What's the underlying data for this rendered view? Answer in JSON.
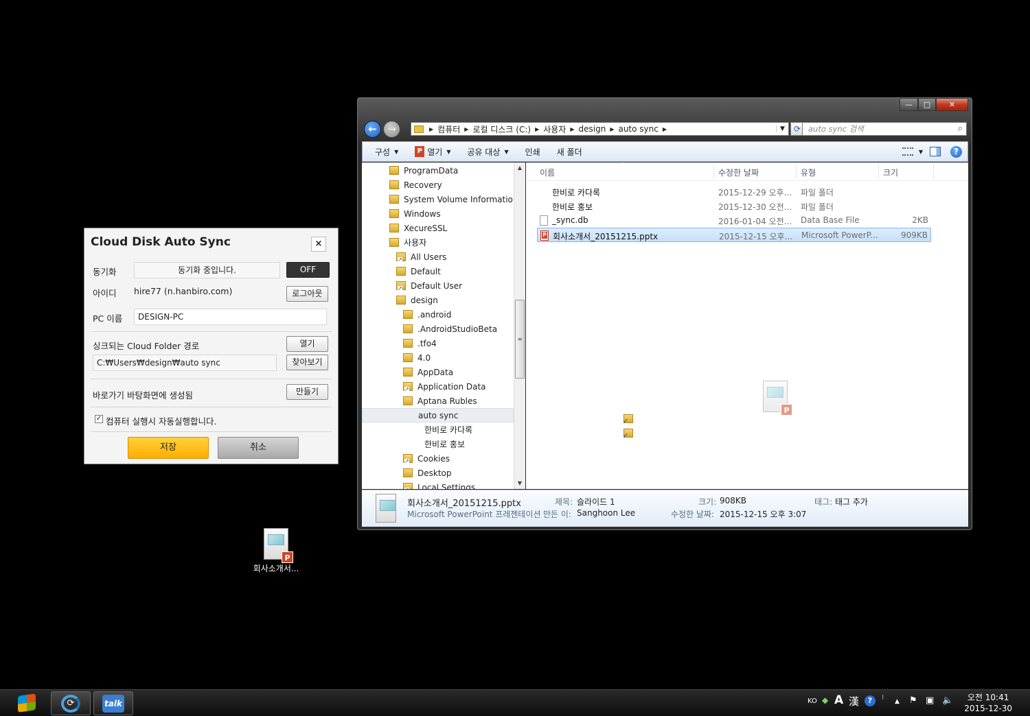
{
  "desktop": {
    "file_icon_label": "회사소개서..."
  },
  "sync_dialog": {
    "title": "Cloud Disk Auto Sync",
    "close": "×",
    "sync_label": "동기화",
    "sync_status": "동기화 중입니다.",
    "off_button": "OFF",
    "id_label": "아이디",
    "id_value": "hire77 (n.hanbiro.com)",
    "logout_button": "로그아웃",
    "pc_name_label": "PC 이름",
    "pc_name_value": "DESIGN-PC",
    "folder_label": "싱크되는 Cloud Folder 경로",
    "open_button": "열기",
    "folder_path": "C:₩Users₩design₩auto sync",
    "browse_button": "찾아보기",
    "shortcut_label": "바로가기 바탕화면에 생성됨",
    "create_button": "만들기",
    "autorun_checked": "✓",
    "autorun_label": "컴퓨터 실행시 자동실행합니다.",
    "save_button": "저장",
    "cancel_button": "취소"
  },
  "explorer": {
    "window_buttons": {
      "minimize": "—",
      "maximize": "□",
      "close": "✕"
    },
    "nav": {
      "back": "←",
      "forward": "→"
    },
    "breadcrumb": [
      "컴퓨터",
      "로컬 디스크 (C:)",
      "사용자",
      "design",
      "auto sync"
    ],
    "search_placeholder": "auto sync 검색",
    "toolbar": {
      "organize": "구성",
      "open": "열기",
      "share": "공유 대상",
      "print": "인쇄",
      "new_folder": "새 폴더"
    },
    "tree": [
      {
        "label": "ProgramData",
        "type": "folder"
      },
      {
        "label": "Recovery",
        "type": "folder"
      },
      {
        "label": "System Volume Information",
        "type": "folder"
      },
      {
        "label": "Windows",
        "type": "folder"
      },
      {
        "label": "XecureSSL",
        "type": "folder"
      },
      {
        "label": "사용자",
        "type": "folder"
      },
      {
        "label": "All Users",
        "type": "short"
      },
      {
        "label": "Default",
        "type": "folder"
      },
      {
        "label": "Default User",
        "type": "short"
      },
      {
        "label": "design",
        "type": "folder"
      },
      {
        "label": ".android",
        "type": "folder"
      },
      {
        "label": ".AndroidStudioBeta",
        "type": "folder"
      },
      {
        "label": ".tfo4",
        "type": "folder"
      },
      {
        "label": "4.0",
        "type": "folder"
      },
      {
        "label": "AppData",
        "type": "folder"
      },
      {
        "label": "Application Data",
        "type": "short"
      },
      {
        "label": "Aptana Rubles",
        "type": "folder"
      },
      {
        "label": "auto sync",
        "type": "sync"
      },
      {
        "label": "한비로 카다록",
        "type": "sync"
      },
      {
        "label": "한비로 홍보",
        "type": "sync"
      },
      {
        "label": "Cookies",
        "type": "short"
      },
      {
        "label": "Desktop",
        "type": "folder"
      },
      {
        "label": "Local Settings",
        "type": "short"
      }
    ],
    "columns": {
      "name": "이름",
      "modified": "수정한 날짜",
      "type": "유형",
      "size": "크기"
    },
    "files": [
      {
        "name": "한비로 카다록",
        "modified": "2015-12-29 오후...",
        "type": "파일 폴더",
        "size": "",
        "icon": "sync-folder"
      },
      {
        "name": "한비로 홍보",
        "modified": "2015-12-30 오전...",
        "type": "파일 폴더",
        "size": "",
        "icon": "sync-folder"
      },
      {
        "name": "_sync.db",
        "modified": "2016-01-04 오전...",
        "type": "Data Base File",
        "size": "2KB",
        "icon": "db-file"
      },
      {
        "name": "회사소개서_20151215.pptx",
        "modified": "2015-12-15 오후...",
        "type": "Microsoft PowerP...",
        "size": "909KB",
        "icon": "pptx-file"
      }
    ],
    "details": {
      "filename": "회사소개서_20151215.pptx",
      "filetype": "Microsoft PowerPoint 프레젠테이션",
      "title_key": "제목:",
      "title_val": "슬라이드 1",
      "author_key": "만든 이:",
      "author_val": "Sanghoon Lee",
      "size_key": "크기:",
      "size_val": "908KB",
      "modified_key": "수정한 날짜:",
      "modified_val": "2015-12-15 오후 3:07",
      "tag_key": "태그:",
      "tag_val": "태그 추가"
    }
  },
  "taskbar": {
    "lang": "KO",
    "ime_a": "A",
    "ime_han": "漢",
    "help": "?",
    "clock_time": "오전 10:41",
    "clock_date": "2015-12-30",
    "talk_label": "talk"
  },
  "colors": {
    "save_button": "#ffb800",
    "selection": "#c6dff7",
    "drag_arrow": "#aab4f0"
  }
}
